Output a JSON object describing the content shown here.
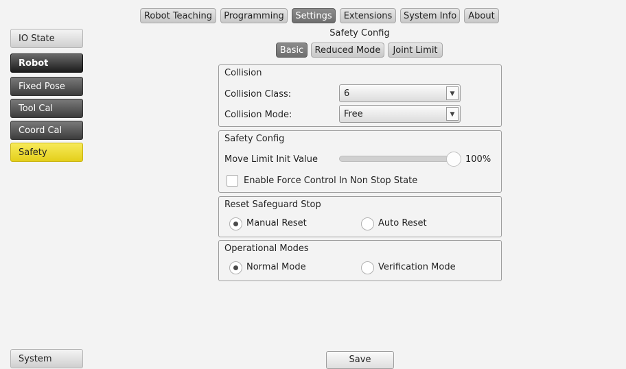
{
  "top_tabs": [
    "Robot Teaching",
    "Programming",
    "Settings",
    "Extensions",
    "System Info",
    "About"
  ],
  "page_title": "Safety Config",
  "sub_tabs": [
    "Basic",
    "Reduced Mode",
    "Joint Limit"
  ],
  "sidebar": {
    "items": [
      "IO State",
      "Robot",
      "Fixed Pose",
      "Tool Cal",
      "Coord Cal",
      "Safety"
    ],
    "bottom": "System"
  },
  "collision": {
    "title": "Collision",
    "class_label": "Collision Class:",
    "class_value": "6",
    "mode_label": "Collision Mode:",
    "mode_value": "Free"
  },
  "safety_config": {
    "title": "Safety Config",
    "move_limit_label": "Move Limit Init Value",
    "move_limit_value": "100%",
    "force_control_label": "Enable Force Control In Non Stop State",
    "force_control_checked": false
  },
  "reset": {
    "title": "Reset Safeguard Stop",
    "options": [
      "Manual Reset",
      "Auto Reset"
    ],
    "selected": "Manual Reset"
  },
  "operational": {
    "title": "Operational Modes",
    "options": [
      "Normal Mode",
      "Verification Mode"
    ],
    "selected": "Normal Mode"
  },
  "save_label": "Save",
  "colors": {
    "active_sidebar": "#e9d42a",
    "active_tab": "#7a7a7a"
  }
}
